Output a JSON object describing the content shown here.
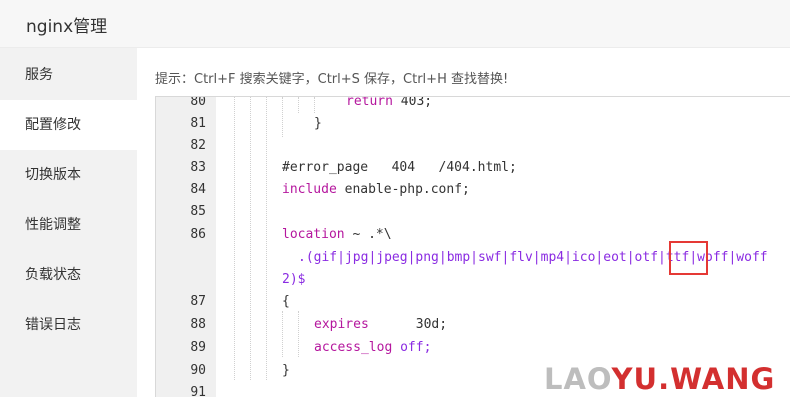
{
  "app": {
    "title": "nginx管理"
  },
  "sidebar": {
    "items": [
      {
        "label": "服务",
        "active": false
      },
      {
        "label": "配置修改",
        "active": true
      },
      {
        "label": "切换版本",
        "active": false
      },
      {
        "label": "性能调整",
        "active": false
      },
      {
        "label": "负载状态",
        "active": false
      },
      {
        "label": "错误日志",
        "active": false
      }
    ]
  },
  "main": {
    "hint": "提示：Ctrl+F 搜索关键字，Ctrl+S 保存，Ctrl+H 查找替换!"
  },
  "editor": {
    "lines": [
      {
        "num": "80",
        "code": "return 403;"
      },
      {
        "num": "81",
        "code": "}"
      },
      {
        "num": "82",
        "code": ""
      },
      {
        "num": "83",
        "code": "#error_page   404   /404.html;"
      },
      {
        "num": "84",
        "code": "include enable-php.conf;"
      },
      {
        "num": "85",
        "code": ""
      },
      {
        "num": "86",
        "code": "location ~ .*\\"
      },
      {
        "num": "",
        "code": ".(gif|jpg|jpeg|png|bmp|swf|flv|mp4|ico|eot|otf|ttf|woff|woff"
      },
      {
        "num": "",
        "code": "2)$"
      },
      {
        "num": "87",
        "code": "{"
      },
      {
        "num": "88",
        "code": "expires      30d;"
      },
      {
        "num": "89",
        "code": "access_log off;"
      },
      {
        "num": "90",
        "code": "}"
      },
      {
        "num": "91",
        "code": ""
      }
    ],
    "tokens": {
      "return_kw": "return",
      "return_val": " 403;",
      "include_kw": "include",
      "include_val": " enable-php.conf;",
      "loc_kw": "location",
      "loc_val": " ~ .*\\",
      "ext_a": ".(gif|jpg|jpeg|png|bmp|swf|flv|mp4|ico|eot|otf|",
      "ext_b": "ttf",
      "ext_c": "|woff|woff",
      "expires_kw": "expires",
      "expires_val": "      30d;",
      "access_kw": "access_log",
      "access_val": " off;"
    }
  },
  "watermark": {
    "part_a": "LAO",
    "part_b": "YU.WANG"
  },
  "colors": {
    "highlight_box": "#e53935",
    "keyword": "#b5179e"
  }
}
